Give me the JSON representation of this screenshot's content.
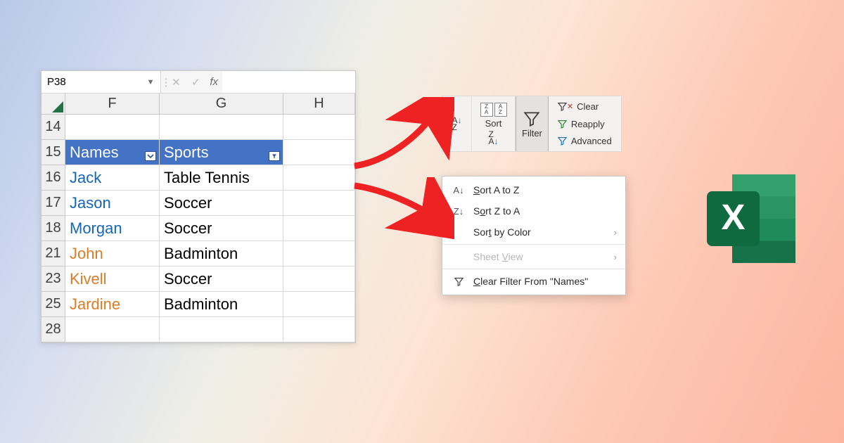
{
  "namebox": {
    "ref": "P38"
  },
  "fx": {
    "cancel": "✕",
    "confirm": "✓",
    "label": "fx"
  },
  "columns": [
    "F",
    "G",
    "H"
  ],
  "header_row": {
    "num": "15",
    "names": "Names",
    "sports": "Sports"
  },
  "rows": [
    {
      "num": "14",
      "name": "",
      "sport": "",
      "cls": ""
    },
    {
      "num": "16",
      "name": "Jack",
      "sport": "Table Tennis",
      "cls": "blue"
    },
    {
      "num": "17",
      "name": "Jason",
      "sport": "Soccer",
      "cls": "blue"
    },
    {
      "num": "18",
      "name": "Morgan",
      "sport": "Soccer",
      "cls": "blue"
    },
    {
      "num": "21",
      "name": "John",
      "sport": "Badminton",
      "cls": "orange"
    },
    {
      "num": "23",
      "name": "Kivell",
      "sport": "Soccer",
      "cls": "orange"
    },
    {
      "num": "25",
      "name": "Jardine",
      "sport": "Badminton",
      "cls": "orange"
    },
    {
      "num": "28",
      "name": "",
      "sport": "",
      "cls": ""
    }
  ],
  "ribbon": {
    "sort_label": "Sort",
    "filter_label": "Filter",
    "clear": "Clear",
    "reapply": "Reapply",
    "advanced": "Advanced"
  },
  "menu": {
    "sort_az": "Sort A to Z",
    "sort_za": "Sort Z to A",
    "sort_color": "Sort by Color",
    "sheet_view": "Sheet View",
    "clear_filter": "Clear Filter From \"Names\""
  }
}
